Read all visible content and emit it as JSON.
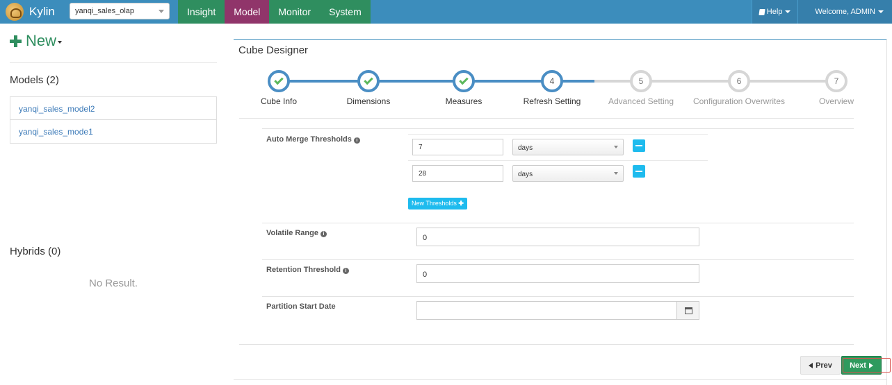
{
  "navbar": {
    "brand": "Kylin",
    "project": "yanqi_sales_olap",
    "tabs": [
      {
        "label": "Insight"
      },
      {
        "label": "Model"
      },
      {
        "label": "Monitor"
      },
      {
        "label": "System"
      }
    ],
    "active_tab": "Model",
    "help_label": "Help",
    "welcome_label": "Welcome, ADMIN"
  },
  "sidebar": {
    "new_label": "New",
    "models_heading": "Models (2)",
    "models": [
      "yanqi_sales_model2",
      "yanqi_sales_mode1"
    ],
    "hybrids_heading": "Hybrids (0)",
    "no_result": "No Result."
  },
  "designer": {
    "title": "Cube Designer",
    "steps": [
      {
        "label": "Cube Info",
        "status": "done"
      },
      {
        "label": "Dimensions",
        "status": "done"
      },
      {
        "label": "Measures",
        "status": "done"
      },
      {
        "label": "Refresh Setting",
        "number": "4",
        "status": "current"
      },
      {
        "label": "Advanced Setting",
        "number": "5",
        "status": "todo"
      },
      {
        "label": "Configuration Overwrites",
        "number": "6",
        "status": "todo"
      },
      {
        "label": "Overview",
        "number": "7",
        "status": "todo"
      }
    ],
    "auto_merge": {
      "label": "Auto Merge Thresholds",
      "rows": [
        {
          "value": "7",
          "unit": "days"
        },
        {
          "value": "28",
          "unit": "days"
        }
      ],
      "new_button": "New Thresholds"
    },
    "volatile_range": {
      "label": "Volatile Range",
      "value": "0"
    },
    "retention_threshold": {
      "label": "Retention Threshold",
      "value": "0"
    },
    "partition_start_date": {
      "label": "Partition Start Date",
      "value": ""
    },
    "prev_button": "Prev",
    "next_button": "Next"
  },
  "colors": {
    "navbar": "#3c8dbc",
    "nav_tab": "#2f8e5f",
    "nav_tab_active": "#90356a",
    "accent_button": "#1ebbee",
    "next_button": "#2e9a5e",
    "step_done": "#4a8ec4"
  }
}
